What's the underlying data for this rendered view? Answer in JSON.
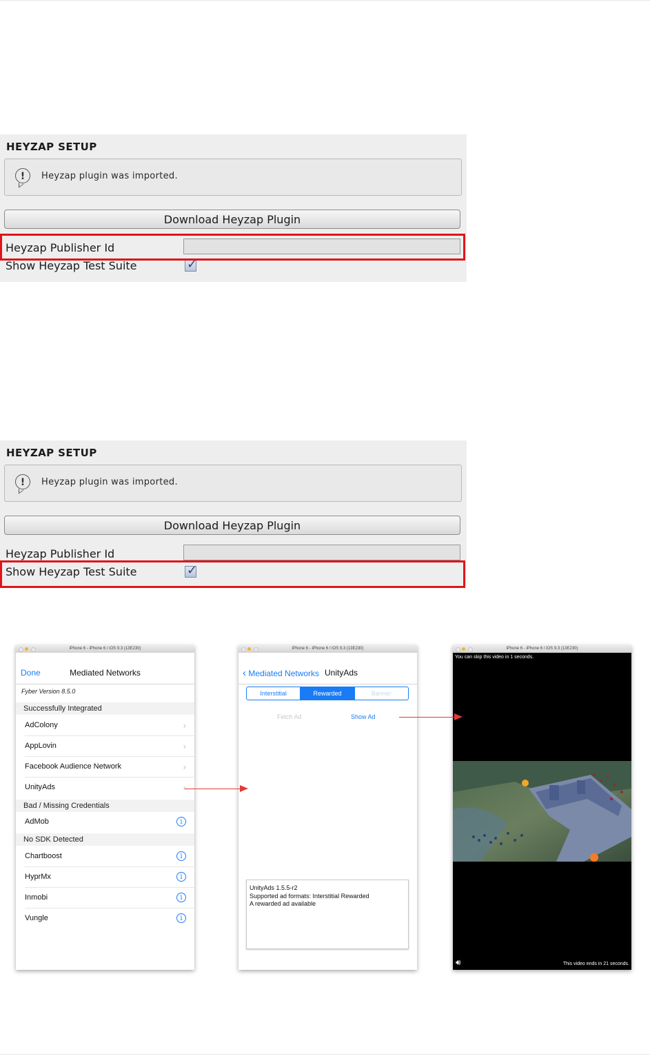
{
  "panel1": {
    "title": "HEYZAP SETUP",
    "message": "Heyzap plugin was imported.",
    "download_button": "Download Heyzap Plugin",
    "publisher_id_label": "Heyzap Publisher Id",
    "publisher_id_value": "",
    "test_suite_label": "Show Heyzap Test Suite",
    "test_suite_checked": true,
    "highlight": "publisher-id"
  },
  "panel2": {
    "title": "HEYZAP SETUP",
    "message": "Heyzap plugin was imported.",
    "download_button": "Download Heyzap Plugin",
    "publisher_id_label": "Heyzap Publisher Id",
    "publisher_id_value": "",
    "test_suite_label": "Show Heyzap Test Suite",
    "test_suite_checked": true,
    "highlight": "test-suite"
  },
  "screen1": {
    "window_title": "iPhone 6 - iPhone 6 / iOS 9.3 (13E230)",
    "done": "Done",
    "title": "Mediated Networks",
    "version": "Fyber Version 8.5.0",
    "sections": [
      {
        "header": "Successfully Integrated",
        "items": [
          "AdColony",
          "AppLovin",
          "Facebook Audience Network",
          "UnityAds"
        ]
      },
      {
        "header": "Bad / Missing Credentials",
        "items": [
          "AdMob"
        ]
      },
      {
        "header": "No SDK Detected",
        "items": [
          "Chartboost",
          "HyprMx",
          "Inmobi",
          "Vungle"
        ]
      }
    ]
  },
  "screen2": {
    "window_title": "iPhone 6 - iPhone 6 / iOS 9.3 (13E230)",
    "back": "Mediated Networks",
    "title": "UnityAds",
    "tabs": [
      "Interstitial",
      "Rewarded",
      "Banner"
    ],
    "active_tab": "Rewarded",
    "fetch_ad": "Fetch Ad",
    "show_ad": "Show Ad",
    "info_lines": [
      "UnityAds 1.5.5-r2",
      "Supported ad formats: Interstitial Rewarded",
      "A rewarded ad available"
    ]
  },
  "screen3": {
    "window_title": "iPhone 6 - iPhone 6 / iOS 9.3 (13E230)",
    "skip_text": "You can skip this video in 1 seconds.",
    "ends_text": "This video ends in 21 seconds.",
    "speaker_icon": "speaker-icon"
  },
  "colors": {
    "highlight": "#e0141a",
    "ios_blue": "#1a7cf5",
    "arrow": "#e53935"
  }
}
